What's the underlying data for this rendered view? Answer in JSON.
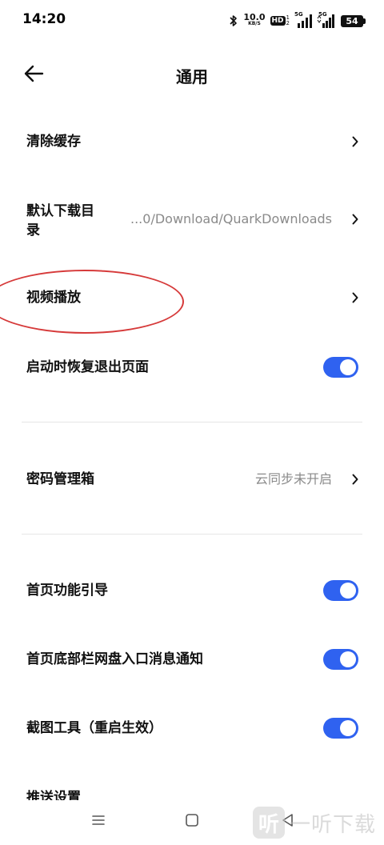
{
  "status_bar": {
    "time": "14:20",
    "net_speed_value": "10.0",
    "net_speed_unit": "KB/S",
    "hd_label": "HD",
    "hd_sub_top": "1",
    "hd_sub_bottom": "2",
    "signal1_label": "5G",
    "signal2_label": "5G",
    "battery": "54",
    "icons": [
      "bluetooth-icon",
      "signal-icon",
      "signal-icon",
      "battery-icon"
    ]
  },
  "header": {
    "title": "通用",
    "back_icon": "arrow-left-icon"
  },
  "settings": {
    "clear_cache": {
      "label": "清除缓存"
    },
    "download_dir": {
      "label_line1": "默认下载目",
      "label_line2": "录",
      "value": "...0/Download/QuarkDownloads"
    },
    "video_playback": {
      "label": "视频播放"
    },
    "restore_pages": {
      "label": "启动时恢复退出页面",
      "enabled": true
    },
    "password_box": {
      "label": "密码管理箱",
      "value": "云同步未开启"
    },
    "home_guide": {
      "label": "首页功能引导",
      "enabled": true
    },
    "netdisk_notice": {
      "label": "首页底部栏网盘入口消息通知",
      "enabled": true
    },
    "screenshot_tool": {
      "label": "截图工具（重启生效）",
      "enabled": true
    },
    "push_settings": {
      "label": "推送设置"
    }
  },
  "colors": {
    "toggle_on": "#2f62f0",
    "annotation": "#d63a3a",
    "secondary_text": "#8a8a8a"
  },
  "watermark": {
    "logo_char": "听",
    "text": "一听下载"
  }
}
